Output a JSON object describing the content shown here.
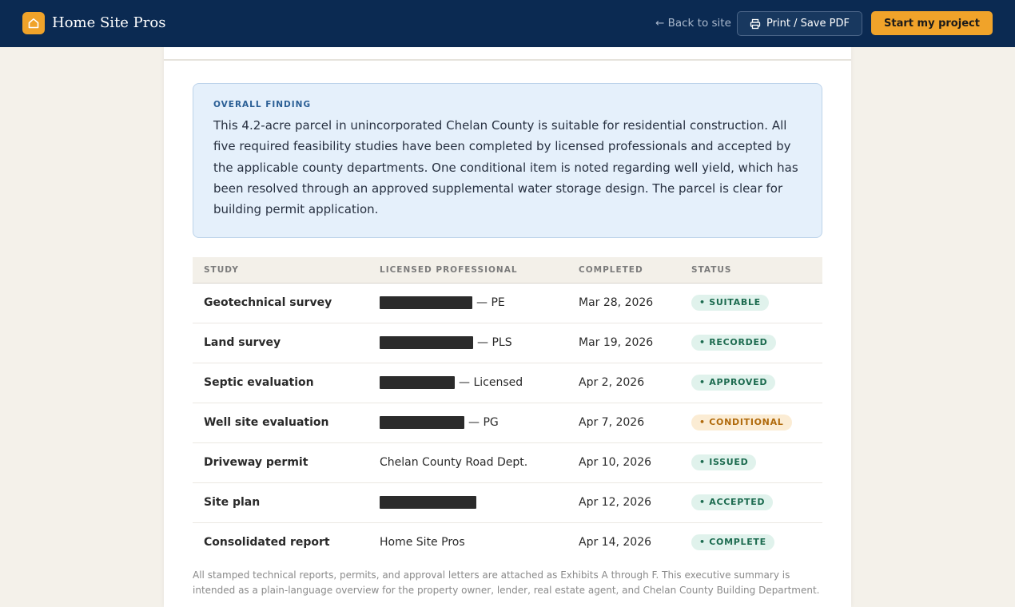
{
  "header": {
    "brand_name": "Home Site Pros",
    "back_link": "← Back to site",
    "print_label": "Print / Save PDF",
    "start_label": "Start my project",
    "brand_color": "#0b2a52",
    "accent_color": "#f0a32a"
  },
  "finding": {
    "label": "OVERALL FINDING",
    "text": "This 4.2-acre parcel in unincorporated Chelan County is suitable for residential construction. All five required feasibility studies have been completed by licensed professionals and accepted by the applicable county departments. One conditional item is noted regarding well yield, which has been resolved through an approved supplemental water storage design. The parcel is clear for building permit application."
  },
  "table": {
    "headers": [
      "STUDY",
      "LICENSED PROFESSIONAL",
      "COMPLETED",
      "STATUS"
    ],
    "rows": [
      {
        "study": "Geotechnical survey",
        "professional": "",
        "credential": "— PE",
        "redacted": true,
        "completed": "Mar 28, 2026",
        "status": "• SUITABLE",
        "status_kind": "ok"
      },
      {
        "study": "Land survey",
        "professional": "",
        "credential": "— PLS",
        "redacted": true,
        "completed": "Mar 19, 2026",
        "status": "• RECORDED",
        "status_kind": "ok"
      },
      {
        "study": "Septic evaluation",
        "professional": "",
        "credential": "— Licensed",
        "redacted": true,
        "completed": "Apr 2, 2026",
        "status": "• APPROVED",
        "status_kind": "ok"
      },
      {
        "study": "Well site evaluation",
        "professional": "",
        "credential": "— PG",
        "redacted": true,
        "completed": "Apr 7, 2026",
        "status": "• CONDITIONAL",
        "status_kind": "warn"
      },
      {
        "study": "Driveway permit",
        "professional": "Chelan County Road Dept.",
        "credential": "",
        "redacted": false,
        "completed": "Apr 10, 2026",
        "status": "• ISSUED",
        "status_kind": "ok"
      },
      {
        "study": "Site plan",
        "professional": "",
        "credential": "",
        "redacted": true,
        "completed": "Apr 12, 2026",
        "status": "• ACCEPTED",
        "status_kind": "ok"
      },
      {
        "study": "Consolidated report",
        "professional": "Home Site Pros",
        "credential": "",
        "redacted": false,
        "completed": "Apr 14, 2026",
        "status": "• COMPLETE",
        "status_kind": "ok"
      }
    ]
  },
  "footnote": "All stamped technical reports, permits, and approval letters are attached as Exhibits A through F. This executive summary is intended as a plain-language overview for the property owner, lender, real estate agent, and Chelan County Building Department."
}
